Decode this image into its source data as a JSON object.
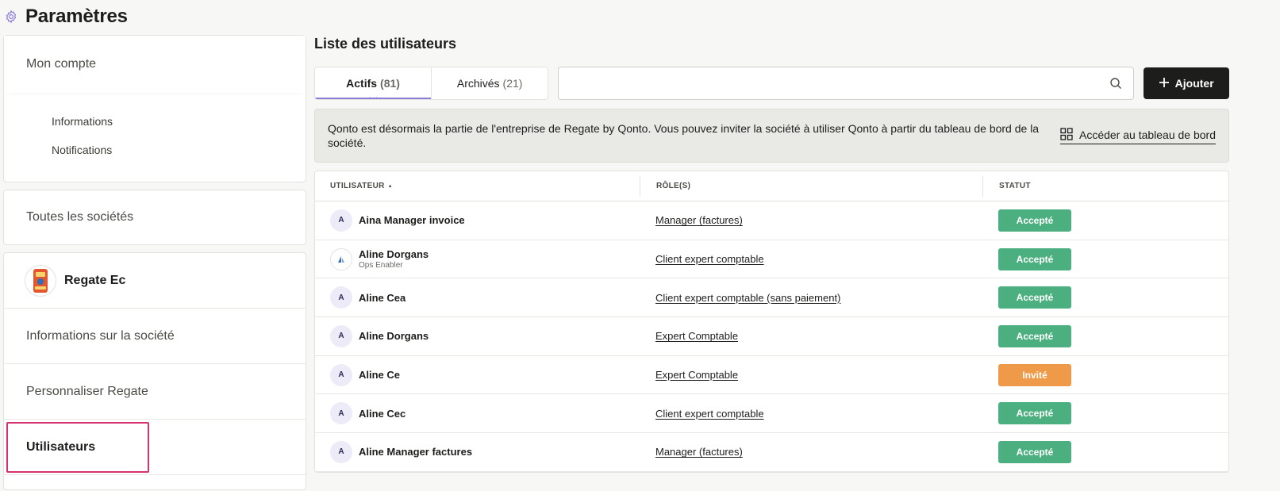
{
  "page": {
    "title": "Paramètres",
    "icon": "gear-icon"
  },
  "sidebar": {
    "account": {
      "title": "Mon compte",
      "items": [
        {
          "label": "Informations"
        },
        {
          "label": "Notifications"
        }
      ]
    },
    "all_companies": "Toutes les sociétés",
    "organization": {
      "name": "Regate Ec",
      "items": [
        {
          "label": "Informations sur la société"
        },
        {
          "label": "Personnaliser Regate"
        },
        {
          "label": "Utilisateurs",
          "active": true
        }
      ]
    }
  },
  "main": {
    "title": "Liste des utilisateurs",
    "tabs": [
      {
        "label": "Actifs",
        "count": "(81)",
        "active": true
      },
      {
        "label": "Archivés",
        "count": "(21)",
        "active": false
      }
    ],
    "search": {
      "value": "",
      "placeholder": ""
    },
    "add_button": "Ajouter",
    "banner": {
      "text": "Qonto est désormais la partie de l'entreprise de Regate by Qonto. Vous pouvez inviter la société à utiliser Qonto à partir du tableau de bord de la société.",
      "link": "Accéder au tableau de bord"
    },
    "table": {
      "headers": {
        "user": "UTILISATEUR",
        "sort_indicator": "▲",
        "roles": "RÔLE(S)",
        "status": "STATUT"
      },
      "rows": [
        {
          "initial": "A",
          "name": "Aina Manager invoice",
          "sub": "",
          "role": "Manager (factures)",
          "status": "Accepté",
          "status_type": "accepted"
        },
        {
          "initial": "",
          "name": "Aline Dorgans",
          "sub": "Ops Enabler",
          "role": "Client expert comptable",
          "status": "Accepté",
          "status_type": "accepted",
          "logo": true
        },
        {
          "initial": "A",
          "name": "Aline Cea",
          "sub": "",
          "role": "Client expert comptable (sans paiement)",
          "status": "Accepté",
          "status_type": "accepted"
        },
        {
          "initial": "A",
          "name": "Aline Dorgans",
          "sub": "",
          "role": "Expert Comptable",
          "status": "Accepté",
          "status_type": "accepted"
        },
        {
          "initial": "A",
          "name": "Aline Ce",
          "sub": "",
          "role": "Expert Comptable",
          "status": "Invité",
          "status_type": "invited"
        },
        {
          "initial": "A",
          "name": "Aline Cec",
          "sub": "",
          "role": "Client expert comptable",
          "status": "Accepté",
          "status_type": "accepted"
        },
        {
          "initial": "A",
          "name": "Aline Manager factures",
          "sub": "",
          "role": "Manager (factures)",
          "status": "Accepté",
          "status_type": "accepted"
        }
      ]
    }
  },
  "colors": {
    "accepted": "#4caf7f",
    "invited": "#ef9a48",
    "active_outline": "#d8326e",
    "tab_accent": "#8e7cd8"
  }
}
